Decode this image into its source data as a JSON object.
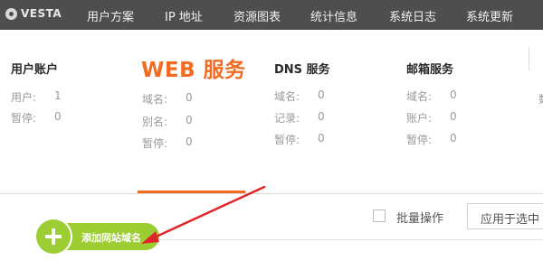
{
  "logo": {
    "text": "VESTA",
    "icon": "vesta-logo-icon"
  },
  "nav": [
    "用户方案",
    "IP 地址",
    "资源图表",
    "统计信息",
    "系统日志",
    "系统更新"
  ],
  "columns": {
    "user": {
      "title": "用户账户",
      "stats": [
        {
          "label": "用户:",
          "value": "1"
        },
        {
          "label": "暂停:",
          "value": "0"
        }
      ]
    },
    "web": {
      "title": "WEB 服务",
      "stats": [
        {
          "label": "域名:",
          "value": "0"
        },
        {
          "label": "别名:",
          "value": "0"
        },
        {
          "label": "暂停:",
          "value": "0"
        }
      ]
    },
    "dns": {
      "title": "DNS 服务",
      "stats": [
        {
          "label": "域名:",
          "value": "0"
        },
        {
          "label": "记录:",
          "value": "0"
        },
        {
          "label": "暂停:",
          "value": "0"
        }
      ]
    },
    "mail": {
      "title": "邮箱服务",
      "stats": [
        {
          "label": "域名:",
          "value": "0"
        },
        {
          "label": "账户:",
          "value": "0"
        },
        {
          "label": "暂停:",
          "value": "0"
        }
      ]
    },
    "next_partial": {
      "text": "数"
    }
  },
  "toolbar": {
    "bulk_label": "批量操作",
    "select_value": "应用于选中"
  },
  "add_button": {
    "label": "添加网站域名"
  },
  "colors": {
    "accent": "#f26b21",
    "nav_bg": "#4e4e4e",
    "add_green": "#9ccd33",
    "arrow": "#e0262b"
  }
}
